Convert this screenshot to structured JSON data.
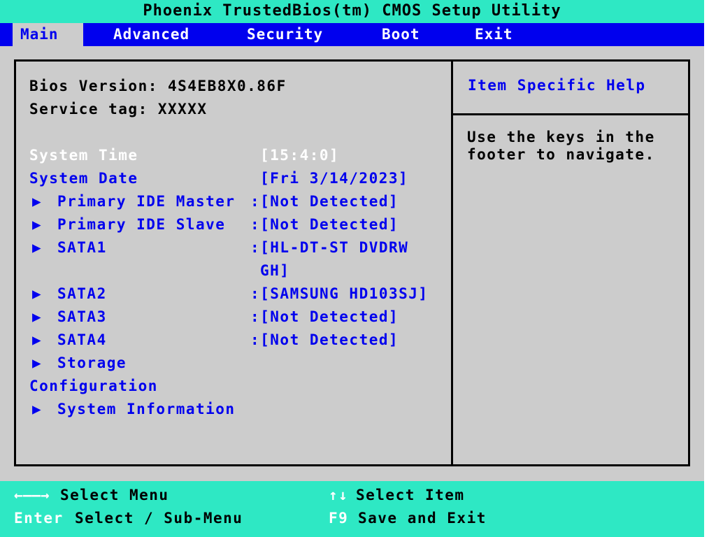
{
  "title": "Phoenix TrustedBios(tm) CMOS Setup Utility",
  "menu": {
    "main": "Main",
    "advanced": "Advanced",
    "security": "Security",
    "boot": "Boot",
    "exit": "Exit",
    "active": "Main"
  },
  "info": {
    "bios_version": "Bios Version: 4S4EB8X0.86F",
    "service_tag": "Service tag: XXXXX"
  },
  "items": {
    "system_time": {
      "label": "System Time",
      "value": "[15:4:0]"
    },
    "system_date": {
      "label": "System Date",
      "value": "[Fri 3/14/2023]"
    },
    "primary_ide_master": {
      "label": "Primary IDE Master",
      "value": ":[Not Detected]"
    },
    "primary_ide_slave": {
      "label": "Primary IDE Slave",
      "value": ":[Not Detected]"
    },
    "sata1": {
      "label": "SATA1",
      "value_line1": ":[HL-DT-ST DVDRW",
      "value_line2": "GH]"
    },
    "sata2": {
      "label": "SATA2",
      "value": ":[SAMSUNG HD103SJ]"
    },
    "sata3": {
      "label": "SATA3",
      "value": ":[Not Detected]"
    },
    "sata4": {
      "label": "SATA4",
      "value": ":[Not Detected]"
    },
    "storage_configuration": {
      "label_line1": "Storage",
      "label_line2": "Configuration"
    },
    "system_information": {
      "label": "System Information"
    }
  },
  "help": {
    "title": "Item Specific Help",
    "text": "Use the keys in the\nfooter to navigate."
  },
  "footer": {
    "left_arrows_key": "←——→",
    "left_arrows_desc": "Select Menu",
    "enter_key": "Enter",
    "enter_desc": "Select / Sub-Menu",
    "updown_key": "↑↓",
    "updown_desc": "Select Item",
    "f9_key": "F9",
    "f9_desc": "Save and Exit"
  },
  "colors": {
    "background": "#cccccc",
    "accent_cyan": "#2ee8c4",
    "menu_blue": "#0000ee",
    "selected_white": "#ffffff"
  },
  "icons": {
    "submenu_arrow": "▶"
  }
}
